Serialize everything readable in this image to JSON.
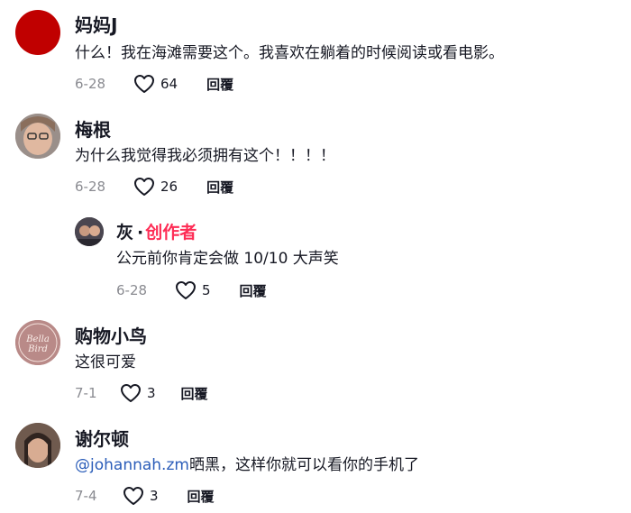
{
  "comments": [
    {
      "username": "妈妈J",
      "text": "什么！我在海滩需要这个。我喜欢在躺着的时候阅读或看电影。",
      "date": "6-28",
      "likes": "64",
      "reply_label": "回覆",
      "avatar_color": "#c00000"
    },
    {
      "username": "梅根",
      "text": "为什么我觉得我必须拥有这个！！！！",
      "date": "6-28",
      "likes": "26",
      "reply_label": "回覆",
      "avatar_color": "#b79c8f"
    },
    {
      "username": "灰",
      "badge_separator": "·",
      "badge": "创作者",
      "text": "公元前你肯定会做 10/10 大声笑",
      "date": "6-28",
      "likes": "5",
      "reply_label": "回覆",
      "avatar_color": "#3c3a3f",
      "badge_color": "#fe2c55"
    },
    {
      "username": "购物小鸟",
      "text": "这很可爱",
      "date": "7-1",
      "likes": "3",
      "reply_label": "回覆",
      "avatar_color": "#b98a88",
      "avatar_logo": "Bella Bird"
    },
    {
      "username": "谢尔顿",
      "mention": "@johannah.zm",
      "text": "晒黑，这样你就可以看你的手机了",
      "date": "7-4",
      "likes": "3",
      "reply_label": "回覆",
      "avatar_color": "#8b6f5f",
      "mention_color": "#2b5db9"
    }
  ],
  "icons": {
    "like": "heart-outline-icon"
  }
}
